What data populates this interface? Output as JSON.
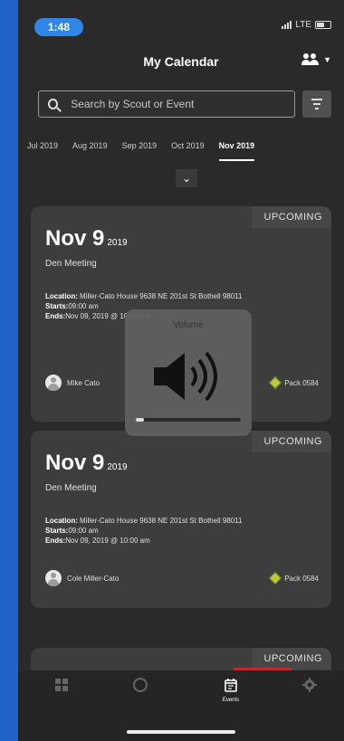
{
  "status": {
    "time": "1:48",
    "network": "LTE"
  },
  "header": {
    "title": "My Calendar"
  },
  "search": {
    "placeholder": "Search by Scout or Event"
  },
  "months": [
    "Jul 2019",
    "Aug 2019",
    "Sep 2019",
    "Oct 2019",
    "Nov 2019"
  ],
  "active_month_index": 4,
  "cards": [
    {
      "badge": "UPCOMING",
      "day": "Nov 9",
      "year": "2019",
      "event": "Den Meeting",
      "location_label": "Location:",
      "location": "Miller-Cato House 9638 NE 201st St Bothell 98011",
      "starts_label": "Starts:",
      "starts": "09:00 am",
      "ends_label": "Ends:",
      "ends": "Nov 09, 2019 @ 10:00 am",
      "person": "Mike Cato",
      "pack": "Pack 0584"
    },
    {
      "badge": "UPCOMING",
      "day": "Nov 9",
      "year": "2019",
      "event": "Den Meeting",
      "location_label": "Location:",
      "location": "Miller-Cato House 9638 NE 201st St Bothell 98011",
      "starts_label": "Starts:",
      "starts": "09:00 am",
      "ends_label": "Ends:",
      "ends": "Nov 09, 2019 @ 10:00 am",
      "person": "Cole Miller-Cato",
      "pack": "Pack 0584"
    },
    {
      "badge": "UPCOMING"
    }
  ],
  "volume": {
    "title": "Volume",
    "level": 0.08
  },
  "tabs": [
    {
      "icon": "dashboard-icon",
      "label": ""
    },
    {
      "icon": "profile-icon",
      "label": ""
    },
    {
      "icon": "calendar-icon",
      "label": "Events"
    },
    {
      "icon": "gear-icon",
      "label": ""
    }
  ],
  "active_tab_index": 2
}
